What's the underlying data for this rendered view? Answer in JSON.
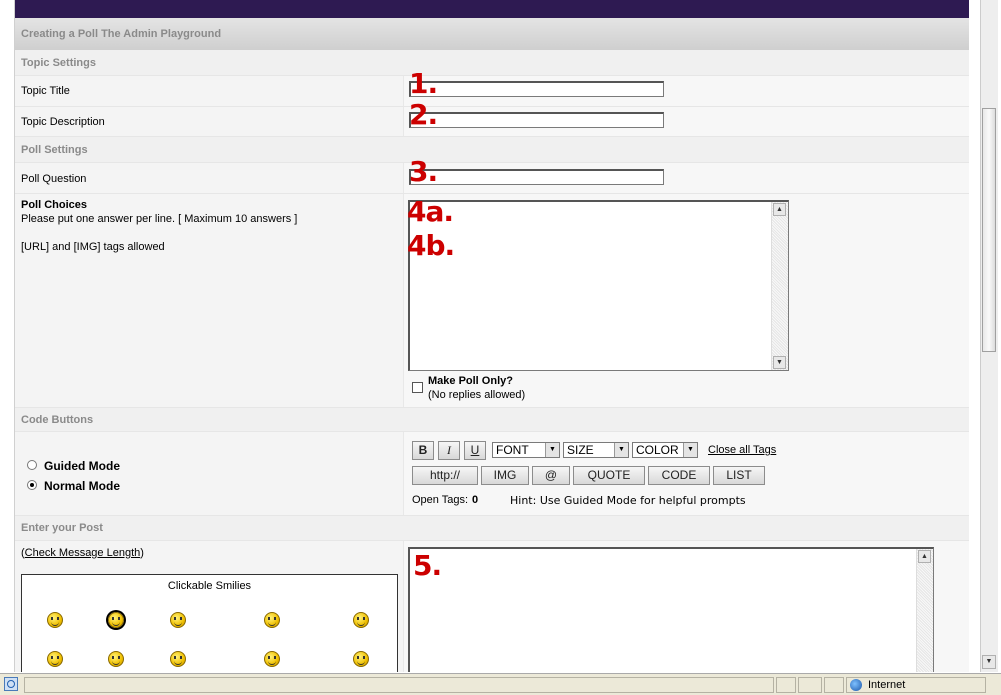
{
  "page": {
    "title": "Creating a Poll The Admin Playground"
  },
  "topic_settings": {
    "heading": "Topic Settings",
    "title_label": "Topic Title",
    "description_label": "Topic Description",
    "title_value": "",
    "description_value": ""
  },
  "poll_settings": {
    "heading": "Poll Settings",
    "question_label": "Poll Question",
    "question_value": "",
    "choices_label": "Poll Choices",
    "choices_help": "Please put one answer per line. [ Maximum 10 answers ]",
    "choices_tags": "[URL] and [IMG] tags allowed",
    "poll_only_label": "Make Poll Only?",
    "poll_only_sub": "(No replies allowed)",
    "poll_only_checked": false
  },
  "annotations": {
    "n1": "1.",
    "n2": "2.",
    "n3": "3.",
    "n4a": "4a.",
    "n4b": "4b.",
    "n5": "5."
  },
  "code_buttons": {
    "heading": "Code Buttons",
    "modes": [
      {
        "label": "Guided Mode",
        "selected": false
      },
      {
        "label": "Normal Mode",
        "selected": true
      }
    ],
    "bold": "B",
    "italic": "I",
    "underline": "U",
    "font_select": "FONT",
    "size_select": "SIZE",
    "color_select": "COLOR",
    "close_tags": "Close all Tags",
    "tag_buttons": [
      "http://",
      "IMG",
      "@",
      "QUOTE",
      "CODE",
      "LIST"
    ],
    "open_tags_label": "Open Tags:",
    "open_tags_count": "0",
    "hint": "Hint: Use Guided Mode for helpful prompts"
  },
  "post": {
    "heading": "Enter your Post",
    "check_length_prefix": "(",
    "check_length_link": "Check Message Length",
    "check_length_suffix": ")",
    "smilies_title": "Clickable Smilies"
  },
  "statusbar": {
    "zone": "Internet"
  },
  "colors": {
    "header_band": "#2e1a52",
    "annotation_red": "#cc0000",
    "section_text": "#8a8a8a"
  }
}
